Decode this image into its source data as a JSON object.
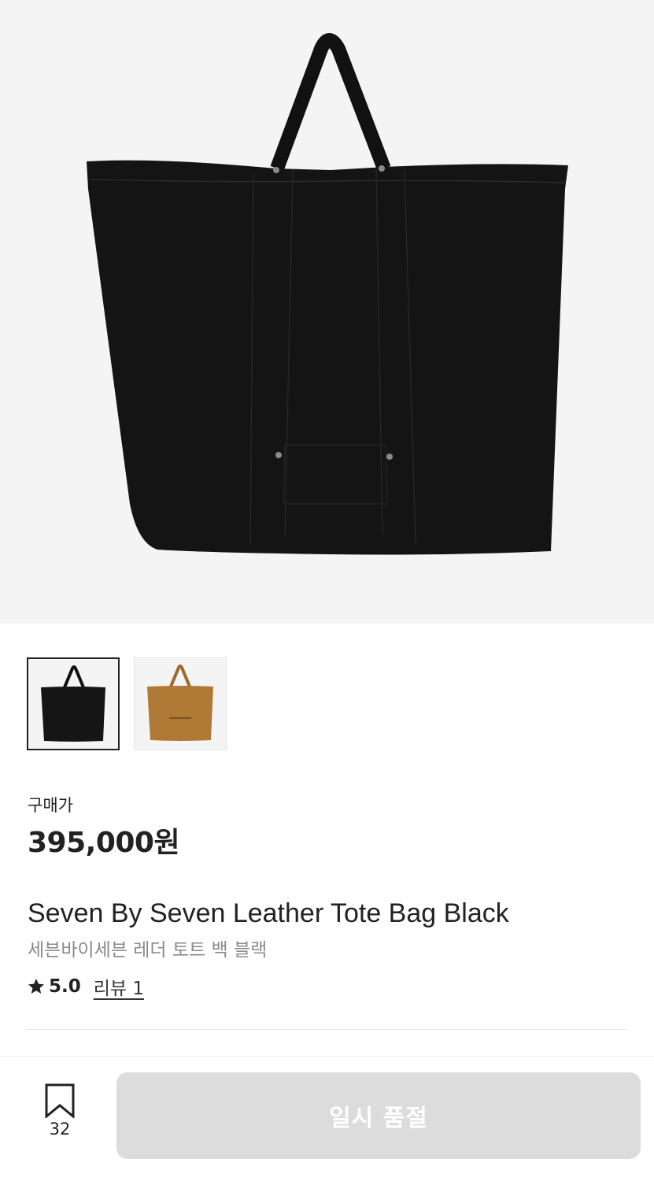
{
  "product": {
    "price_label": "구매가",
    "price": "395,000원",
    "name_en": "Seven By Seven Leather Tote Bag Black",
    "name_ko": "세븐바이세븐 레더 토트 백 블랙",
    "rating": "5.0",
    "review_link": "리뷰 1"
  },
  "images": {
    "thumbnails": [
      {
        "icon": "black-tote-bag-thumbnail",
        "selected": true
      },
      {
        "icon": "brown-tote-bag-thumbnail",
        "selected": false
      }
    ]
  },
  "bottom_bar": {
    "bookmark_count": "32",
    "soldout_label": "일시 품절"
  },
  "colors": {
    "hero_background": "#f4f4f4",
    "disabled_button": "#dcdcdc",
    "text_primary": "#222222",
    "text_secondary": "#8a8a8a"
  }
}
